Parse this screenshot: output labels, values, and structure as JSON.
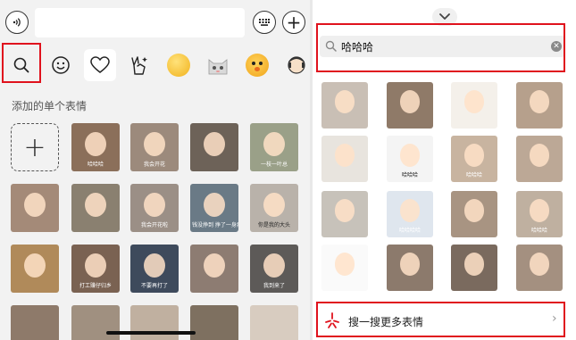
{
  "left_panel": {
    "section_title": "添加的单个表情",
    "add_symbol": "+",
    "buttons": {
      "voice_glyph": "◉",
      "add_glyph": "+"
    },
    "sticker_captions": [
      "哈哈哈",
      "我会开花",
      "",
      "一枝一叶总",
      "",
      "",
      "我会开花啦",
      "钱没挣到\n挣了一身病",
      "你是我的大头",
      "",
      "打工赚仔归乡",
      "不要再打了",
      "",
      "我到来了"
    ]
  },
  "right_panel": {
    "search": {
      "query": "哈哈哈",
      "clear_glyph": "✕"
    },
    "sticker_captions": [
      "",
      "",
      "",
      "",
      "",
      "哈哈哈",
      "哈哈哈",
      "",
      "",
      "哈哈哈哈",
      "",
      "哈哈哈",
      "",
      "",
      "",
      ""
    ],
    "more_row": {
      "label": "搜一搜更多表情",
      "arrow": "›"
    }
  },
  "colors": {
    "highlight_red": "#e0121d",
    "panel_bg": "#f2f2f2"
  }
}
